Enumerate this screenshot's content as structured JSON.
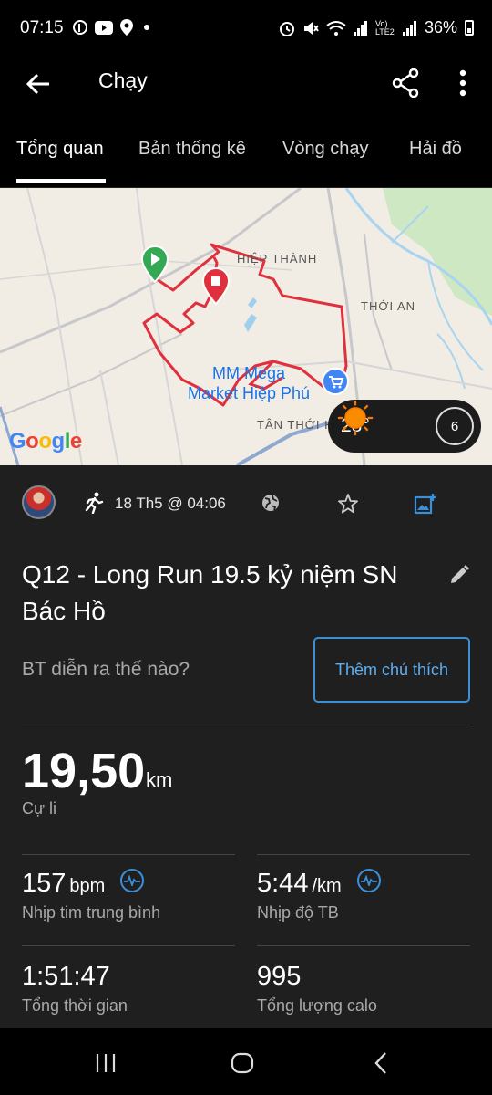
{
  "status_bar": {
    "time": "07:15",
    "battery": "36%",
    "network_label": "Vo) LTE2"
  },
  "app_bar": {
    "title": "Chạy"
  },
  "tabs": [
    {
      "label": "Tổng quan",
      "active": true
    },
    {
      "label": "Bản thống kê",
      "active": false
    },
    {
      "label": "Vòng chạy",
      "active": false
    },
    {
      "label": "Hải đồ",
      "active": false
    }
  ],
  "map": {
    "labels": {
      "hiep_thanh": "HIỆP THÀNH",
      "thoi_an": "THỚI AN",
      "tan_thoi": "TÂN THỚI H",
      "poi_line1": "MM Mega",
      "poi_line2": "Market Hiệp Phú"
    },
    "google": "Google",
    "weather": {
      "temp": "28°",
      "wind": "6"
    }
  },
  "activity": {
    "date": "18 Th5 @ 04:06",
    "title": "Q12 - Long Run 19.5 kỷ niệm SN Bác Hồ",
    "prompt": "BT diễn ra thế nào?",
    "note_button": "Thêm chú thích"
  },
  "stats": {
    "distance": {
      "value": "19,50",
      "unit": "km",
      "label": "Cự li"
    },
    "heart_rate": {
      "value": "157",
      "unit": "bpm",
      "label": "Nhịp tim trung bình"
    },
    "pace": {
      "value": "5:44",
      "unit": "/km",
      "label": "Nhịp độ TB"
    },
    "time": {
      "value": "1:51:47",
      "label": "Tổng thời gian"
    },
    "calories": {
      "value": "995",
      "label": "Tổng lượng calo"
    }
  },
  "colors": {
    "accent": "#3b8fd6",
    "route": "#e0303e",
    "start": "#34a853"
  }
}
